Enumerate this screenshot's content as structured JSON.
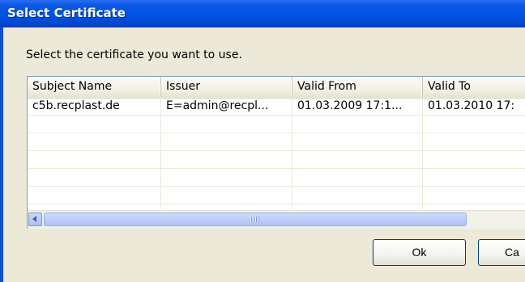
{
  "window": {
    "title": "Select Certificate"
  },
  "prompt": "Select the certificate you want to use.",
  "list": {
    "columns": [
      "Subject Name",
      "Issuer",
      "Valid From",
      "Valid To"
    ],
    "rows": [
      [
        "c5b.recplast.de",
        "E=admin@recpl...",
        "01.03.2009 17:1...",
        "01.03.2010 17:"
      ]
    ],
    "empty_rows": 5
  },
  "scrollbar": {
    "left_icon": "scroll-left-arrow-icon",
    "grip_icon": "scroll-grip-icon"
  },
  "buttons": {
    "ok": "Ok",
    "cancel": "Ca"
  },
  "colors": {
    "titlebar": "#0054e3",
    "dialog_bg": "#ece9d8",
    "button_border": "#003c74"
  }
}
